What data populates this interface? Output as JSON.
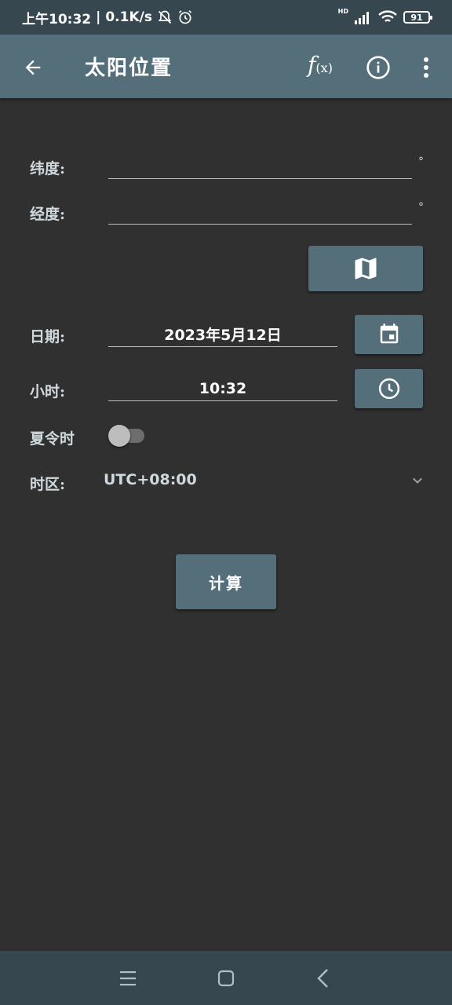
{
  "status": {
    "time": "上午10:32",
    "speed": "0.1K/s",
    "network": "HD",
    "battery": "91"
  },
  "app_bar": {
    "title": "太阳位置",
    "fx_f": "f",
    "fx_x": "(x)"
  },
  "form": {
    "latitude_label": "纬度:",
    "latitude_value": "",
    "latitude_unit": "°",
    "longitude_label": "经度:",
    "longitude_value": "",
    "longitude_unit": "°",
    "date_label": "日期:",
    "date_value": "2023年5月12日",
    "hour_label": "小时:",
    "hour_value": "10:32",
    "dst_label": "夏令时",
    "dst_on": false,
    "timezone_label": "时区:",
    "timezone_value": "UTC+08:00",
    "calculate_label": "计算"
  },
  "colors": {
    "background": "#303030",
    "app_bar": "#546e7a",
    "status_bar": "#37474f",
    "button": "#546e7a"
  },
  "icons": {
    "back": "arrow-left-icon",
    "fx": "function-icon",
    "info": "info-icon",
    "more": "more-vert-icon",
    "map": "map-icon",
    "calendar": "calendar-icon",
    "clock": "clock-icon",
    "chevron": "chevron-down-icon"
  }
}
